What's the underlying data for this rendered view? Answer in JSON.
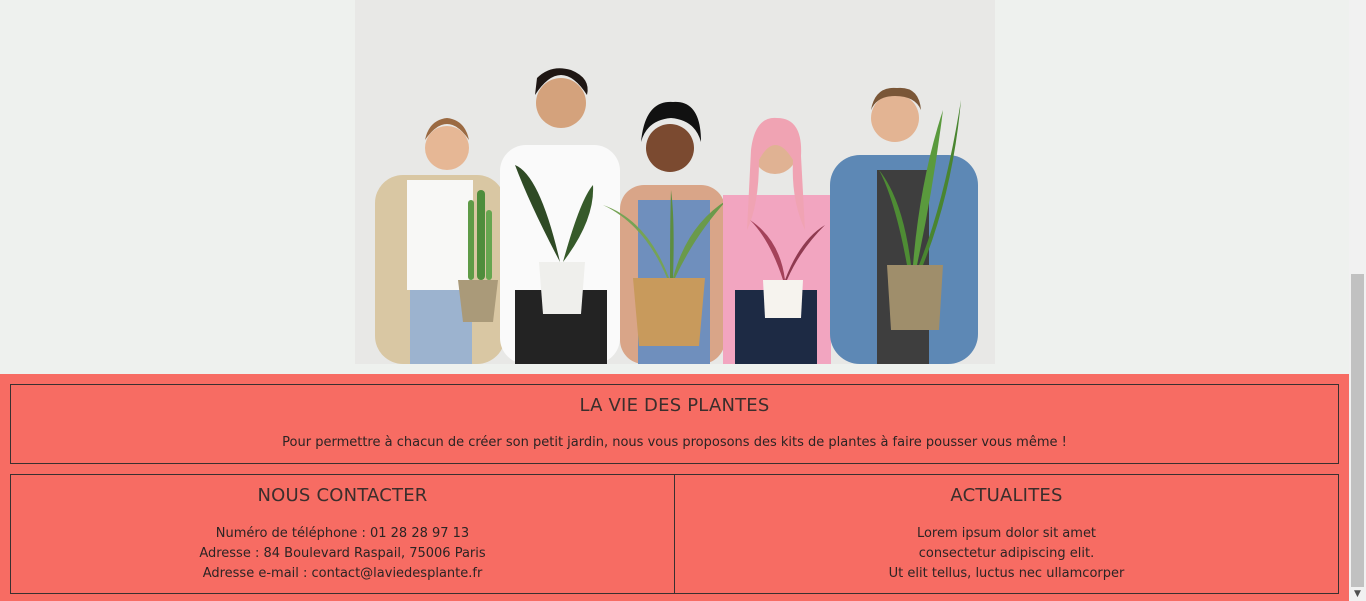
{
  "hero": {
    "image_alt": "Five people holding potted plants"
  },
  "about": {
    "title": "LA VIE DES PLANTES",
    "text": "Pour permettre à chacun de créer son petit jardin, nous vous proposons des kits de plantes à faire pousser vous même !"
  },
  "contact": {
    "title": "NOUS CONTACTER",
    "lines": [
      "Numéro de téléphone : 01 28 28 97 13",
      "Adresse : 84 Boulevard Raspail, 75006 Paris",
      "Adresse e-mail : contact@laviedesplante.fr"
    ]
  },
  "news": {
    "title": "ACTUALITES",
    "lines": [
      "Lorem ipsum dolor sit amet",
      "consectetur adipiscing elit.",
      "Ut elit tellus, luctus nec ullamcorper"
    ]
  },
  "colors": {
    "footer_bg": "#f76c63",
    "page_bg": "#eef1ee"
  }
}
